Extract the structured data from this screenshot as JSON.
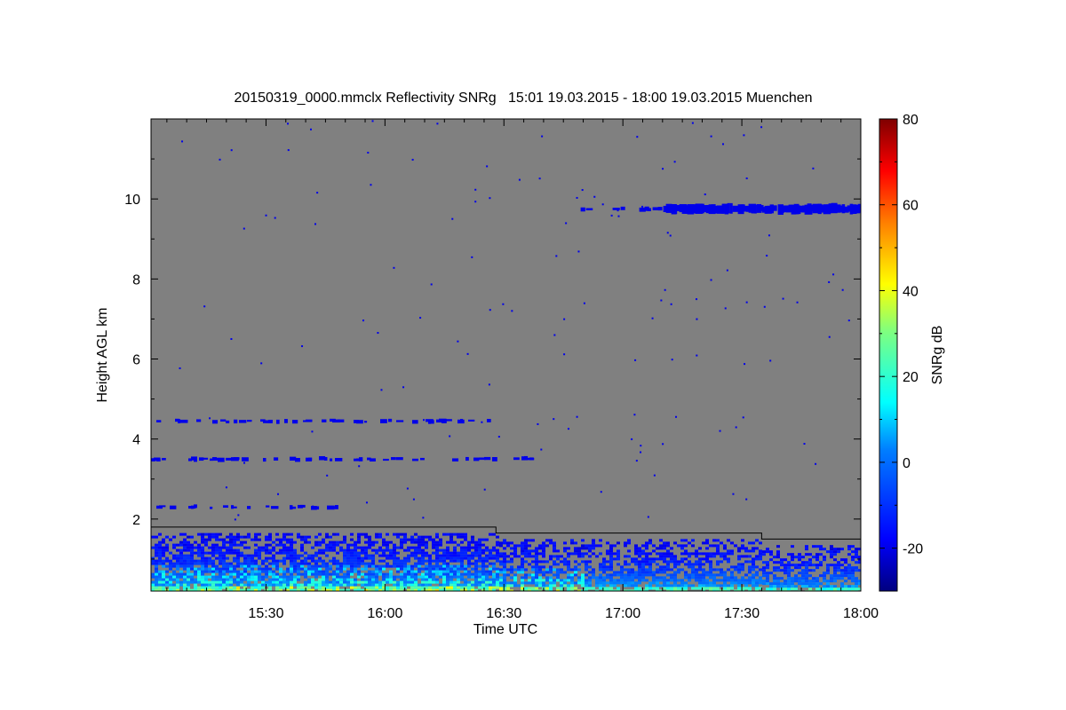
{
  "chart_data": {
    "type": "heatmap",
    "title": "20150319_0000.mmclx Reflectivity SNRg   15:01 19.03.2015 - 18:00 19.03.2015 Muenchen",
    "xlabel": "Time UTC",
    "ylabel": "Height AGL km",
    "x_start": "15:01",
    "x_end": "18:00",
    "x_ticks": [
      "15:30",
      "16:00",
      "16:30",
      "17:00",
      "17:30",
      "18:00"
    ],
    "x_tick_minutes": [
      30,
      60,
      90,
      120,
      150,
      180
    ],
    "xlim_minutes": [
      1,
      180
    ],
    "y_ticks": [
      2,
      4,
      6,
      8,
      10
    ],
    "ylim": [
      0.2,
      12
    ],
    "colorbar": {
      "label": "SNRg dB",
      "ticks": [
        -20,
        0,
        20,
        40,
        60,
        80
      ],
      "range": [
        -30,
        80
      ],
      "colors": [
        "#00007f",
        "#0000ff",
        "#007fff",
        "#00ffff",
        "#7fff7f",
        "#ffff00",
        "#ff7f00",
        "#ff0000",
        "#7f0000"
      ]
    },
    "background_color": "#808080",
    "cloud_base_line": {
      "points_minutes_km": [
        [
          1,
          1.8
        ],
        [
          88,
          1.8
        ],
        [
          88,
          1.65
        ],
        [
          155,
          1.65
        ],
        [
          155,
          1.5
        ],
        [
          180,
          1.5
        ]
      ]
    },
    "echo_layers": [
      {
        "t0": 1,
        "t1": 88,
        "h": 4.45,
        "snr": -20
      },
      {
        "t0": 1,
        "t1": 99,
        "h": 3.5,
        "snr": -20
      },
      {
        "t0": 1,
        "t1": 48,
        "h": 2.3,
        "snr": -20
      },
      {
        "t0": 108,
        "t1": 180,
        "h": 9.75,
        "snr": -20
      },
      {
        "t0": 1,
        "t1": 180,
        "h": 0.5,
        "snr": 0
      }
    ]
  }
}
